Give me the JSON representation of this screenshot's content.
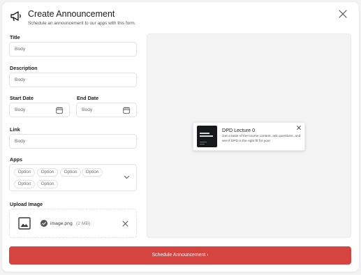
{
  "header": {
    "title": "Create Announcement",
    "subtitle": "Schedule an announcement to our apps with this form.",
    "icon": "megaphone-icon",
    "close_icon": "close-icon"
  },
  "form": {
    "title": {
      "label": "Title",
      "value": "Body"
    },
    "description": {
      "label": "Description",
      "value": "Body"
    },
    "start_date": {
      "label": "Start Date",
      "value": "Body",
      "icon": "calendar-icon"
    },
    "end_date": {
      "label": "End Date",
      "value": "Body",
      "icon": "calendar-icon"
    },
    "link": {
      "label": "Link",
      "value": "Body"
    },
    "apps": {
      "label": "Apps",
      "options": [
        "Option",
        "Option",
        "Option",
        "Option",
        "Option",
        "Option"
      ],
      "icon": "chevron-down-icon"
    },
    "upload": {
      "label": "Upload Image",
      "file_name": "image.png",
      "file_size": "(2 MB)",
      "icons": [
        "image-icon",
        "check-circle-icon",
        "close-icon"
      ]
    }
  },
  "preview": {
    "notification": {
      "title": "DPD Lecture 0",
      "body": "Get a taste of the course content, ask questions, and see if DPD is the right fit for you!",
      "close_icon": "close-icon"
    }
  },
  "submit": {
    "label": "Schedule Announcement  ›"
  },
  "colors": {
    "accent": "#d6443f",
    "background": "#f3f3f4",
    "card": "#ffffff",
    "border": "#e3e3e6",
    "thumbnail": "#17181c"
  }
}
